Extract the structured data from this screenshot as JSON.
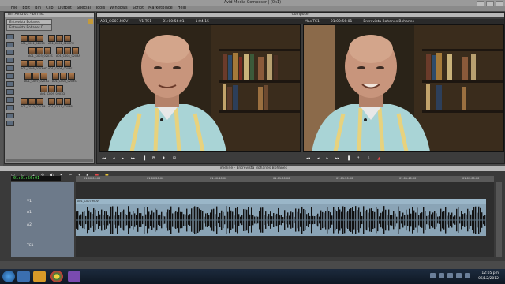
{
  "app_title": "Avid Media Composer | (0k1)",
  "menu": [
    "File",
    "Edit",
    "Bin",
    "Clip",
    "Output",
    "Special",
    "Tools",
    "Windows",
    "Script",
    "Marketplace",
    "Help"
  ],
  "bin": {
    "title": "Bin AVID 01 - bin list",
    "tabs": [
      "Entrevista Bohanes",
      "Entrevista Bohanes D"
    ],
    "clips": [
      {
        "name": "A01_C001_0203S"
      },
      {
        "name": "A01_C002_0203FK"
      },
      {
        "name": "A01_C003_0203S"
      },
      {
        "name": "A01_C004_0203A"
      },
      {
        "name": "A01_C005_0203HD"
      },
      {
        "name": "A01_C006_0203F"
      },
      {
        "name": "A01_C007_0203G"
      },
      {
        "name": "A01_C008_0203S"
      },
      {
        "name": "A01_C009_0203D"
      },
      {
        "name": "A01_C010_0203M"
      },
      {
        "name": "A01_C011_0203R"
      }
    ]
  },
  "composer": {
    "title": "Composer",
    "left_monitor": {
      "clip": "A01_CO07.MOV",
      "tc1": "V1 TC1",
      "tc2": "01:00:56:01",
      "dur": "1:04:15"
    },
    "right_monitor": {
      "clip": "Mas TC1",
      "tc": "01:00:56:01",
      "title": "Entrevista Bohanes Bohanes"
    }
  },
  "timeline": {
    "title": "Timeline - Entrevista Bohanes Bohanes",
    "timecode": "01:01:56:01",
    "ruler": [
      "01:00:00:00",
      "01:00:20:00",
      "01:00:40:00",
      "01:01:00:00",
      "01:01:20:00",
      "01:01:40:00",
      "01:02:00:00"
    ],
    "tracks": [
      "V1",
      "A1",
      "A2",
      "TC1"
    ],
    "video_clip": "A01_C007.MOV"
  },
  "taskbar": {
    "time": "12:05 pm",
    "date": "06/12/2012"
  }
}
